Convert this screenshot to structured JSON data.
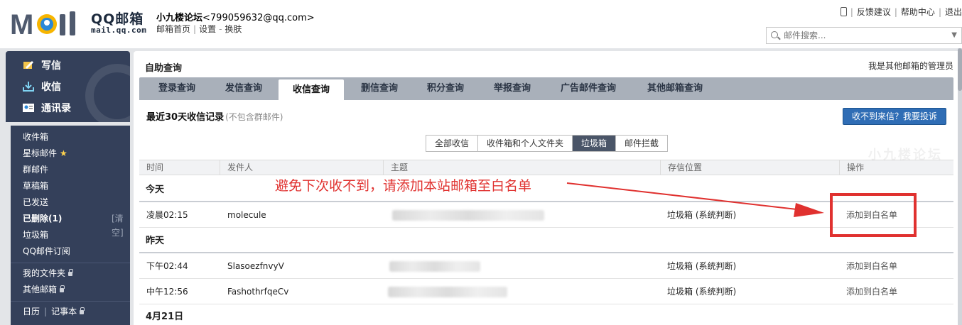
{
  "header": {
    "logo_cn": "QQ邮箱",
    "logo_url": "mail.qq.com",
    "user_name": "小九楼论坛",
    "user_email": "<799059632@qq.com>",
    "links": [
      "邮箱首页",
      "设置",
      "换肤"
    ],
    "top_links": [
      "反馈建议",
      "帮助中心",
      "退出"
    ],
    "search_placeholder": "邮件搜索..."
  },
  "sidebar": {
    "main": [
      {
        "label": "写信",
        "icon": "pencil-icon"
      },
      {
        "label": "收信",
        "icon": "inbox-download-icon"
      },
      {
        "label": "通讯录",
        "icon": "contacts-icon"
      }
    ],
    "items": [
      "收件箱",
      "星标邮件",
      "群邮件",
      "草稿箱",
      "已发送",
      "已删除(1)",
      "垃圾箱",
      "QQ邮件订阅"
    ],
    "clear_label": "[清空]",
    "folders": [
      "我的文件夹",
      "其他邮箱"
    ],
    "calendar": "日历",
    "notebook": "记事本"
  },
  "main": {
    "title": "自助查询",
    "admin_link": "我是其他邮箱的管理员",
    "tabs": [
      "登录查询",
      "发信查询",
      "收信查询",
      "删信查询",
      "积分查询",
      "举报查询",
      "广告邮件查询",
      "其他邮箱查询"
    ],
    "active_tab": "收信查询",
    "records_title": "最近30天收信记录",
    "records_note": "(不包含群邮件)",
    "complain_button": "收不到来信？我要投诉",
    "filters": [
      "全部收信",
      "收件箱和个人文件夹",
      "垃圾箱",
      "邮件拦截"
    ],
    "active_filter": "垃圾箱",
    "columns": [
      "时间",
      "发件人",
      "主题",
      "存信位置",
      "操作"
    ],
    "groups": [
      {
        "label": "今天",
        "rows": [
          {
            "time": "凌晨02:15",
            "sender": "molecule",
            "location": "垃圾箱 (系统判断)",
            "action": "添加到白名单"
          }
        ]
      },
      {
        "label": "昨天",
        "rows": [
          {
            "time": "下午02:44",
            "sender": "SlasoezfnvyV",
            "location": "垃圾箱 (系统判断)",
            "action": "添加到白名单"
          },
          {
            "time": "中午12:56",
            "sender": "FashothrfqeCv",
            "location": "垃圾箱 (系统判断)",
            "action": "添加到白名单"
          }
        ]
      },
      {
        "label": "4月21日",
        "rows": []
      }
    ]
  },
  "annotation": {
    "text": "避免下次收不到，请添加本站邮箱至白名单",
    "color": "#e0312f"
  },
  "colors": {
    "sidebar_bg": "#34405a",
    "tabbar_bg": "#a9b0ba",
    "button_blue": "#2f6db5"
  }
}
